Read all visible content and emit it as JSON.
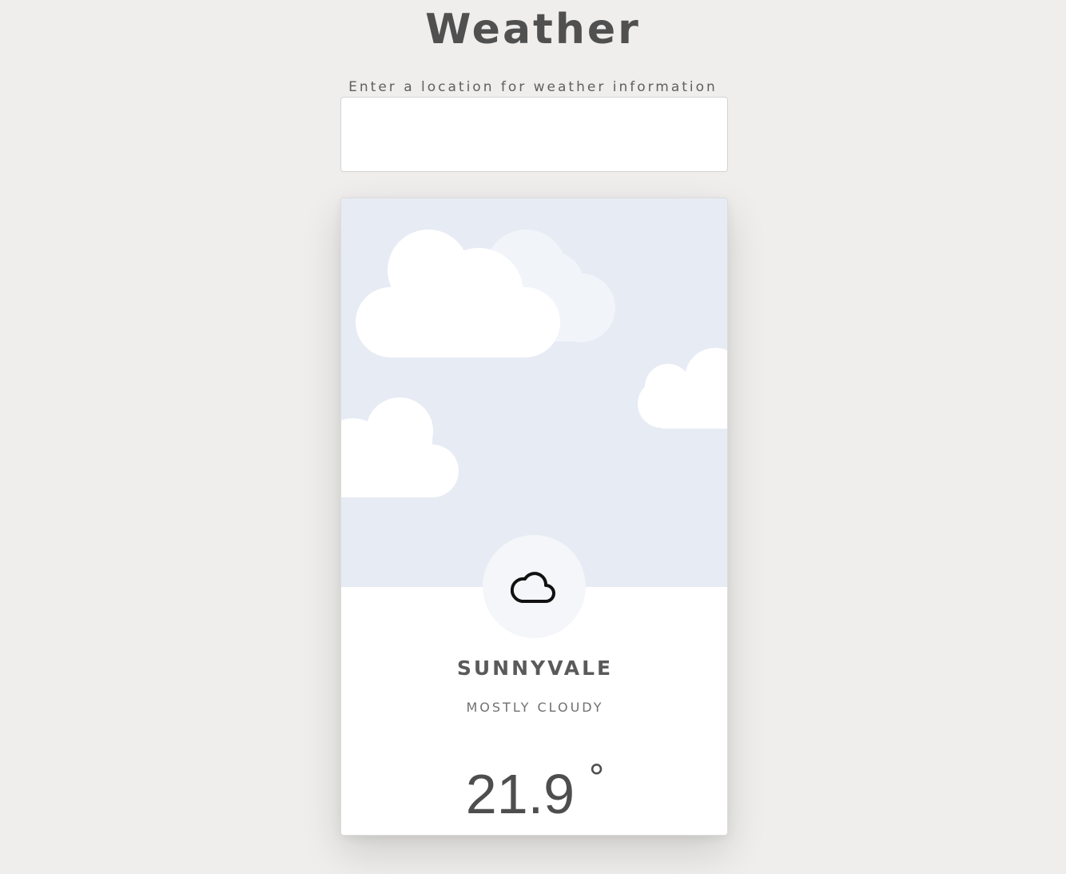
{
  "app": {
    "title": "Weather"
  },
  "search": {
    "label": "Enter a location for weather information",
    "value": "",
    "placeholder": ""
  },
  "weather": {
    "city": "SUNNYVALE",
    "condition": "MOSTLY CLOUDY",
    "temperature": "21.9",
    "unit": "°",
    "icon": "cloud-icon"
  },
  "colors": {
    "background": "#efeeec",
    "sky": "#e7ebf4",
    "cloud": "#ffffff",
    "cloud_faded": "#f1f4f9",
    "text": "#505050"
  }
}
